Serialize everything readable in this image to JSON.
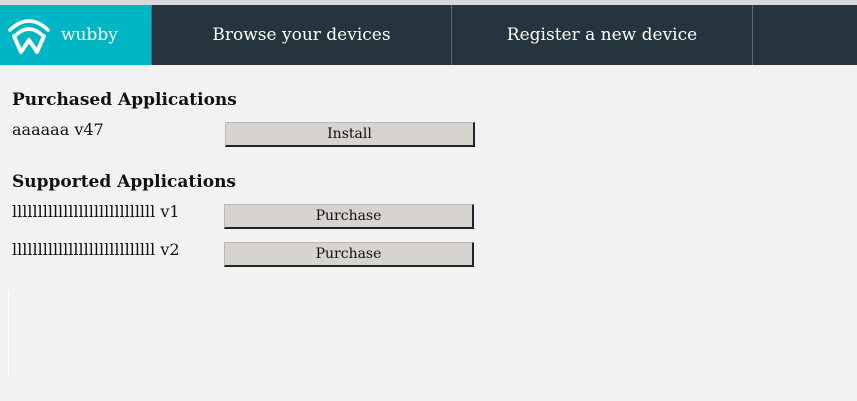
{
  "brand": {
    "logo_icon": "wubby-logo-icon",
    "name": "wubby",
    "accent_color": "#00b5c4"
  },
  "nav": {
    "background_color": "#26353d",
    "items": [
      {
        "label": "Browse your devices"
      },
      {
        "label": "Register a new device"
      }
    ]
  },
  "purchased": {
    "title": "Purchased Applications",
    "apps": [
      {
        "name": "aaaaaa v47",
        "button_label": "Install"
      }
    ]
  },
  "supported": {
    "title": "Supported Applications",
    "apps": [
      {
        "name": "llllllllllllllllllllllllllll v1",
        "button_label": "Purchase"
      },
      {
        "name": "llllllllllllllllllllllllllll v2",
        "button_label": "Purchase"
      }
    ]
  }
}
